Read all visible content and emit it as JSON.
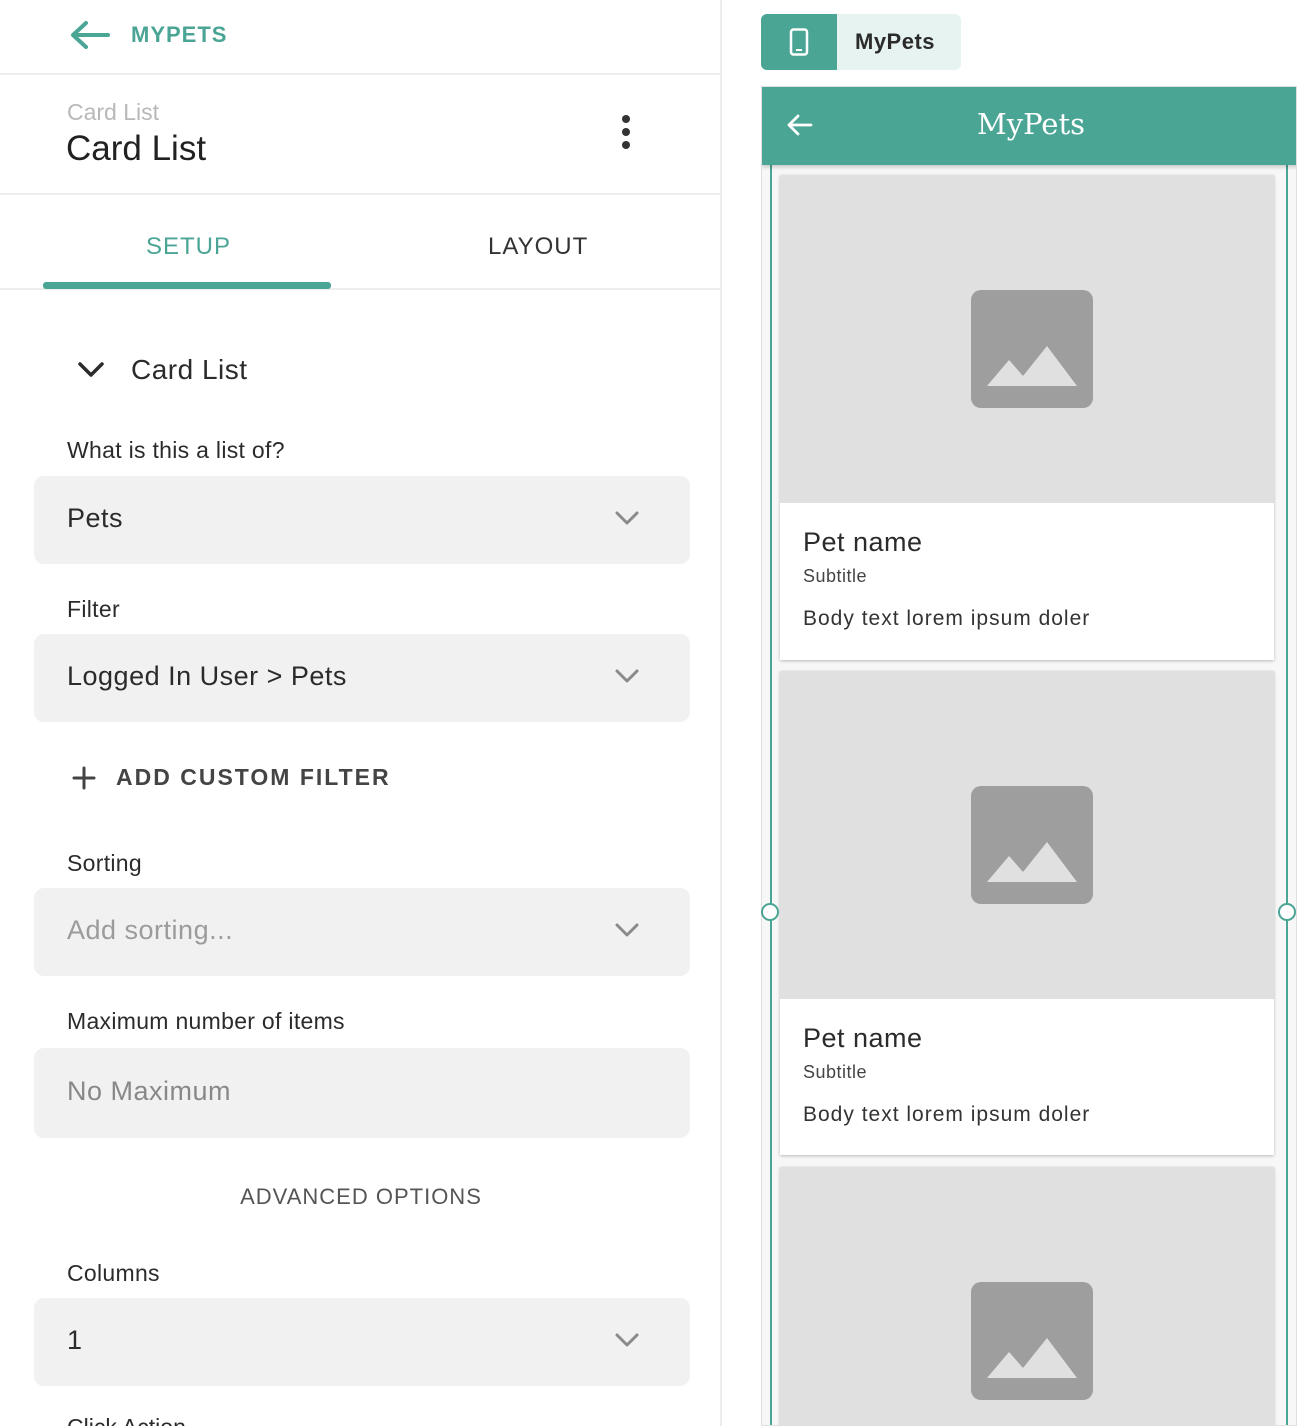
{
  "nav": {
    "back_label": "MYPETS"
  },
  "component": {
    "subtitle": "Card List",
    "title": "Card List"
  },
  "tabs": {
    "setup": "SETUP",
    "layout": "LAYOUT",
    "active": "SETUP"
  },
  "section": {
    "title": "Card List"
  },
  "fields": {
    "list_of": {
      "label": "What is this a list of?",
      "value": "Pets"
    },
    "filter": {
      "label": "Filter",
      "value": "Logged In User > Pets"
    },
    "add_filter_label": "ADD CUSTOM FILTER",
    "sorting": {
      "label": "Sorting",
      "placeholder": "Add sorting..."
    },
    "max_items": {
      "label": "Maximum number of items",
      "placeholder": "No Maximum"
    },
    "advanced_label": "ADVANCED OPTIONS",
    "columns": {
      "label": "Columns",
      "value": "1"
    },
    "next_label_partial": "Click Action"
  },
  "preview": {
    "device_label": "MyPets",
    "app_title": "MyPets",
    "cards": [
      {
        "title": "Pet name",
        "subtitle": "Subtitle",
        "body": "Body text lorem ipsum doler"
      },
      {
        "title": "Pet name",
        "subtitle": "Subtitle",
        "body": "Body text lorem ipsum doler"
      },
      {
        "title": "",
        "subtitle": "",
        "body": ""
      }
    ]
  },
  "colors": {
    "accent": "#4aa595",
    "field_bg": "#f1f1f1",
    "image_placeholder": "#e0e0e0",
    "image_icon": "#9e9e9e"
  },
  "icons": [
    "back-arrow-icon",
    "more-vert-icon",
    "chevron-down-icon",
    "plus-icon",
    "phone-icon",
    "image-placeholder-icon"
  ]
}
